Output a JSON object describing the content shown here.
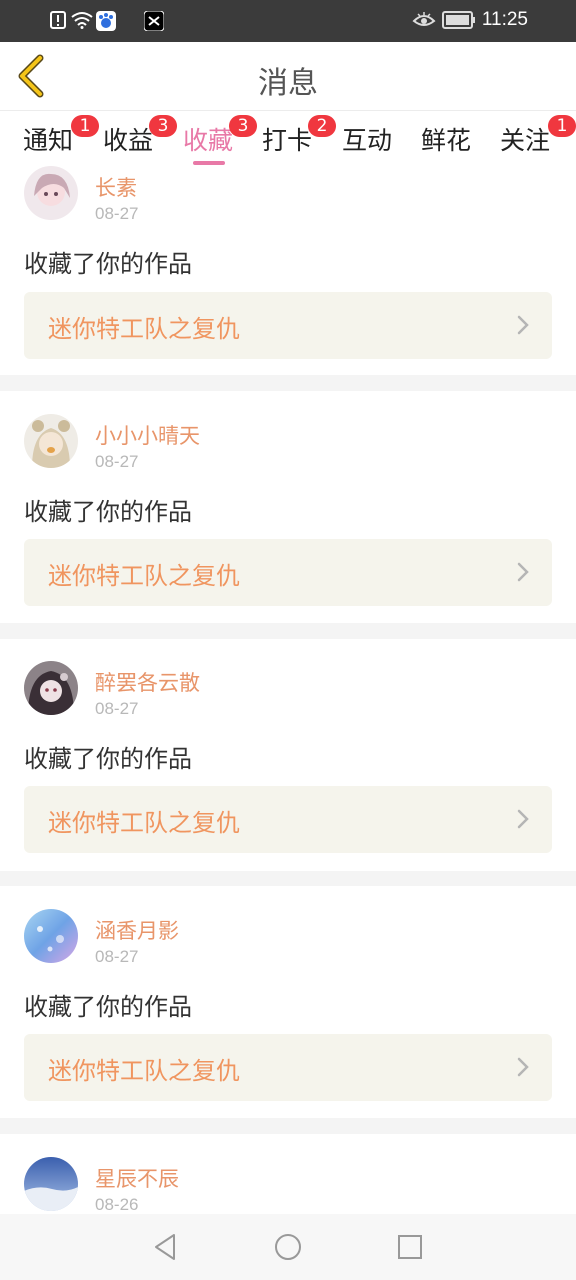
{
  "status_bar": {
    "time": "11:25",
    "icons": [
      "alert-icon",
      "wifi-icon",
      "baidu-app-icon",
      "capcut-app-icon",
      "eye-icon",
      "battery-icon"
    ]
  },
  "header": {
    "title": "消息",
    "back_icon": "chevron-left-icon"
  },
  "tabs": [
    {
      "label": "通知",
      "badge": "1"
    },
    {
      "label": "收益",
      "badge": "3"
    },
    {
      "label": "收藏",
      "badge": "3",
      "active": true
    },
    {
      "label": "打卡",
      "badge": "2"
    },
    {
      "label": "互动",
      "badge": ""
    },
    {
      "label": "鲜花",
      "badge": ""
    },
    {
      "label": "关注",
      "badge": "1"
    }
  ],
  "notifications": [
    {
      "user": "长素",
      "date": "08-27",
      "message": "收藏了你的作品",
      "work": "迷你特工队之复仇"
    },
    {
      "user": "小小小晴天",
      "date": "08-27",
      "message": "收藏了你的作品",
      "work": "迷你特工队之复仇"
    },
    {
      "user": "醉罢各云散",
      "date": "08-27",
      "message": "收藏了你的作品",
      "work": "迷你特工队之复仇"
    },
    {
      "user": "涵香月影",
      "date": "08-27",
      "message": "收藏了你的作品",
      "work": "迷你特工队之复仇"
    },
    {
      "user": "星辰不辰",
      "date": "08-26",
      "message": "",
      "work": ""
    }
  ],
  "nav_bar": {
    "icons": [
      "back-triangle-icon",
      "home-circle-icon",
      "recents-square-icon"
    ]
  },
  "colors": {
    "accent": "#e879a7",
    "username": "#e8956a",
    "work_title": "#f0955f",
    "badge": "#f0373f",
    "back_chevron": "#f5c518"
  }
}
